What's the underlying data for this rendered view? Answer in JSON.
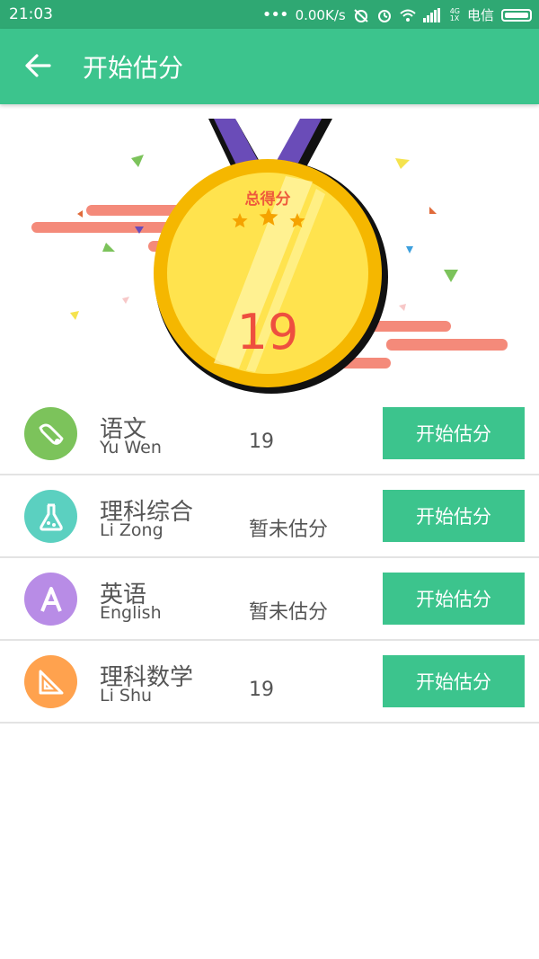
{
  "status_bar": {
    "time": "21:03",
    "speed": "0.00K/s",
    "network_small": "4G\n1X",
    "carrier": "电信",
    "icons": [
      "more-dots-icon",
      "alarm-off-icon",
      "alarm-clock-icon",
      "wifi-icon",
      "signal-icon",
      "battery-icon"
    ]
  },
  "app_bar": {
    "title": "开始估分",
    "back_icon": "arrow-left-icon"
  },
  "medal": {
    "label": "总得分",
    "stars": 3,
    "score": "19",
    "colors": {
      "gold": "#ffd12e",
      "gold_light": "#ffec5e",
      "ribbon": "#6a4cb8",
      "score_text": "#ee4f3f",
      "swoosh": "#f48a7a"
    }
  },
  "subjects": [
    {
      "name_cn": "语文",
      "name_en": "Yu Wen",
      "score": "19",
      "button": "开始估分",
      "icon": "scroll-icon",
      "icon_color": "#7cc35b"
    },
    {
      "name_cn": "理科综合",
      "name_en": "Li Zong",
      "score": "暂未估分",
      "button": "开始估分",
      "icon": "flask-icon",
      "icon_color": "#5bd0c0"
    },
    {
      "name_cn": "英语",
      "name_en": "English",
      "score": "暂未估分",
      "button": "开始估分",
      "icon": "letter-a-icon",
      "icon_color": "#b88ce6"
    },
    {
      "name_cn": "理科数学",
      "name_en": "Li Shu",
      "score": "19",
      "button": "开始估分",
      "icon": "set-square-icon",
      "icon_color": "#ffa24e"
    }
  ],
  "theme": {
    "primary": "#3cc48d",
    "status_bar": "#2fa873"
  }
}
